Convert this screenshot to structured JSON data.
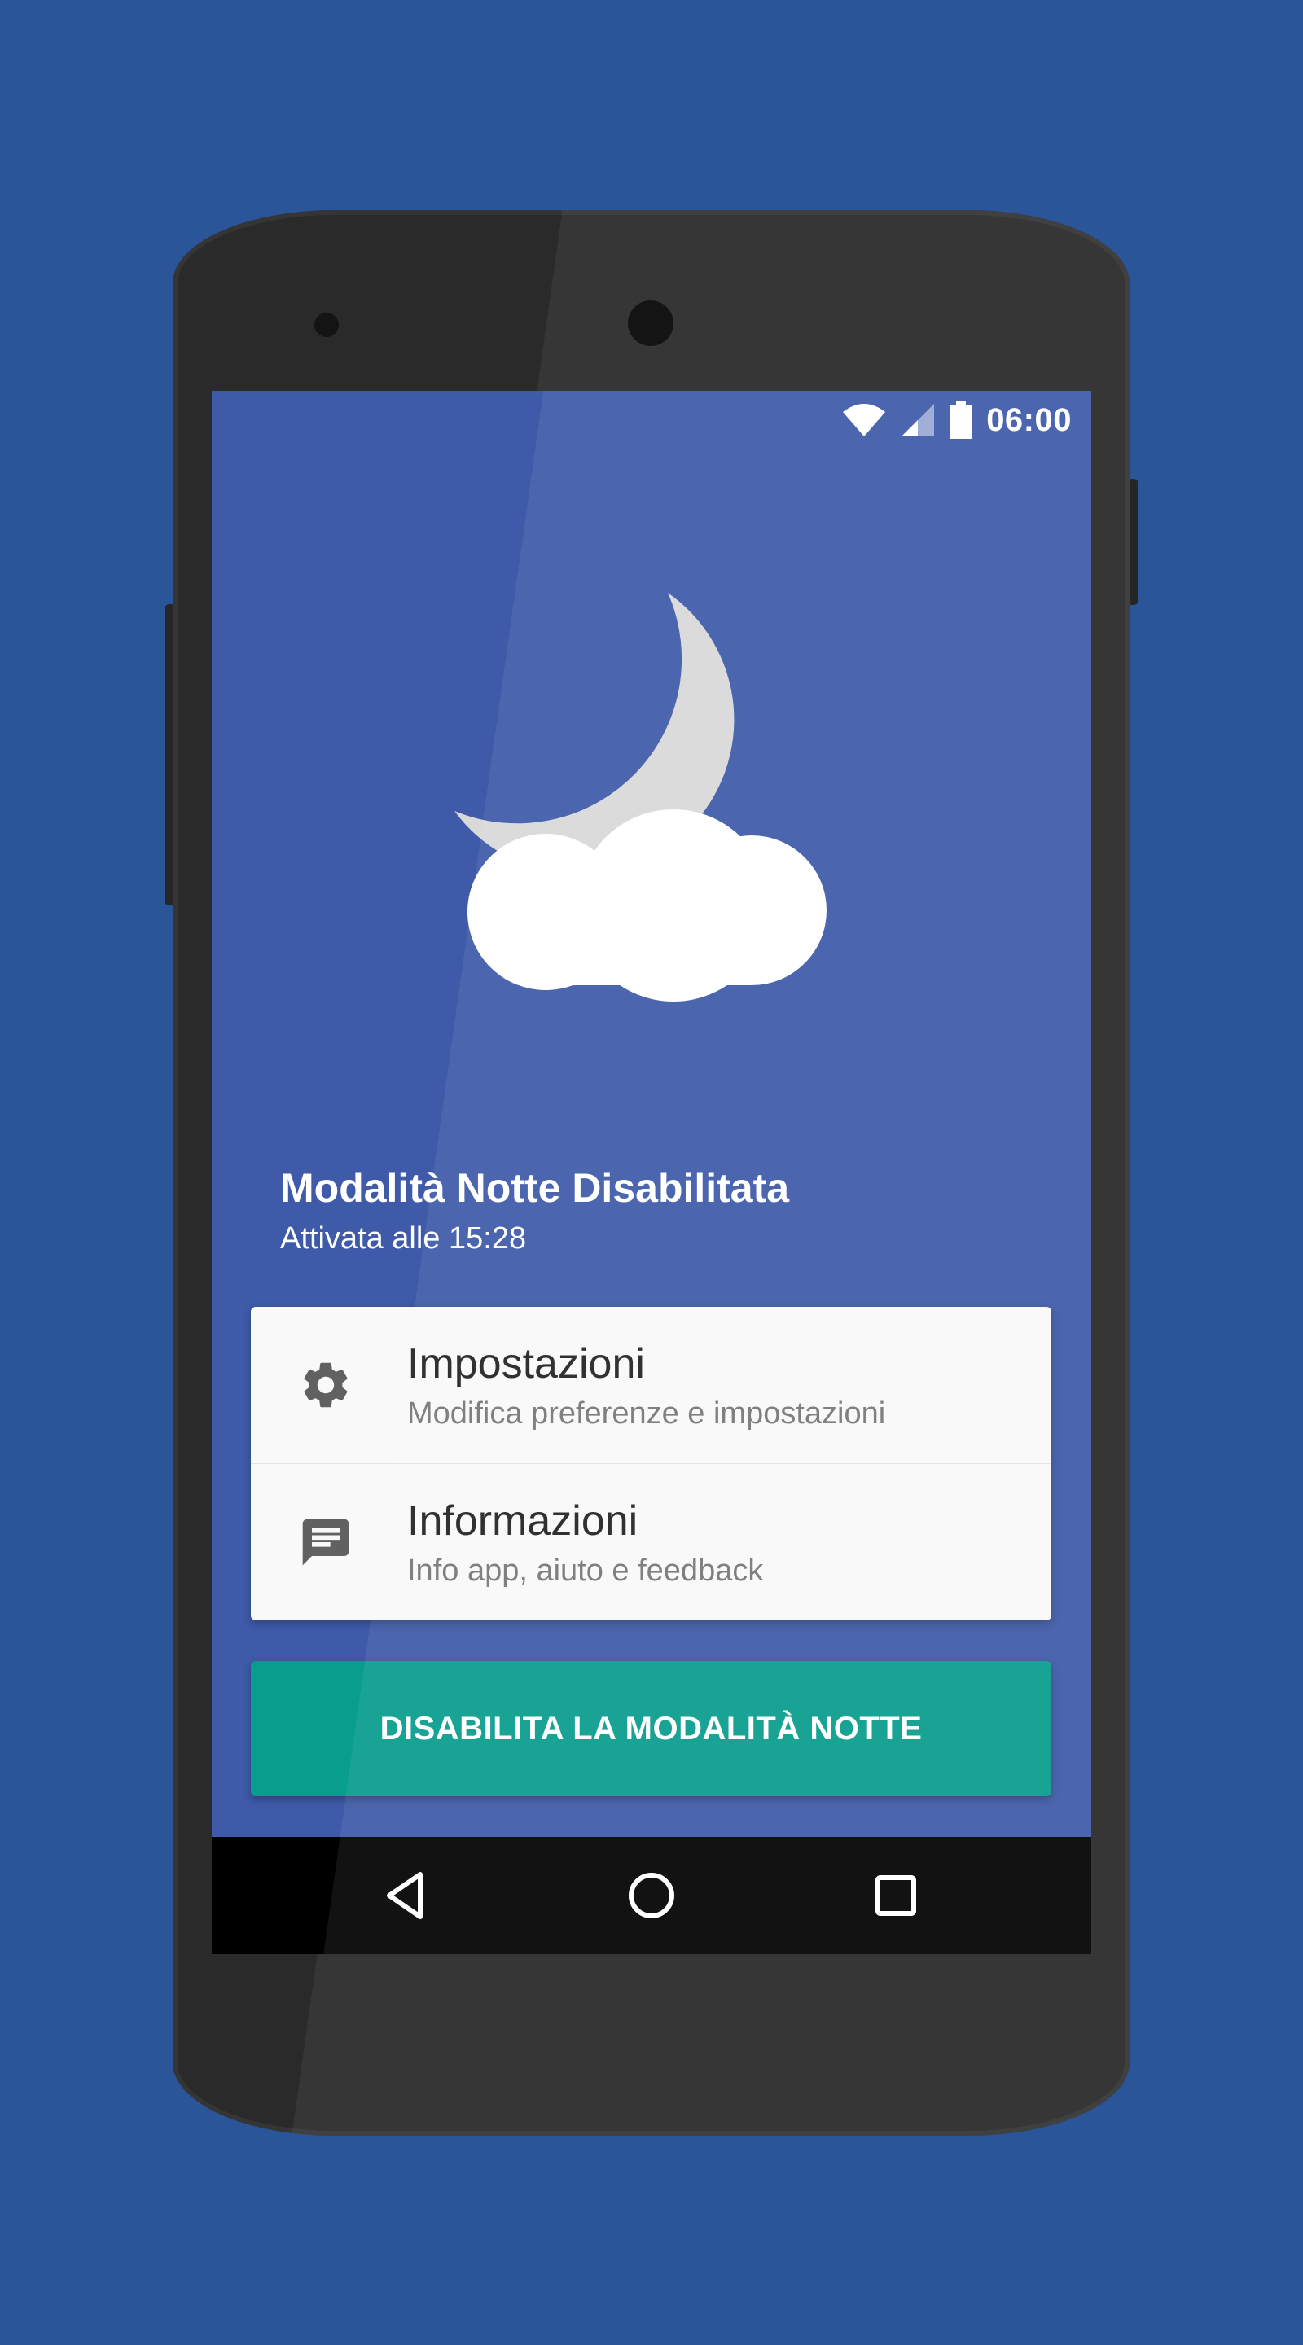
{
  "colors": {
    "background": "#2a5699",
    "screen": "#3e5aa8",
    "card": "#f9f9f9",
    "accent_button": "#089d8d",
    "nav_bar": "#000000",
    "moon": "#d9d9d9",
    "cloud": "#ffffff"
  },
  "status_bar": {
    "time": "06:00",
    "icons": [
      "wifi-icon",
      "cell-signal-icon",
      "battery-icon"
    ]
  },
  "illustration": {
    "icons": [
      "moon-icon",
      "cloud-icon"
    ]
  },
  "header": {
    "title": "Modalità Notte Disabilitata",
    "subtitle": "Attivata  alle 15:28"
  },
  "menu": {
    "items": [
      {
        "icon": "gear-icon",
        "title": "Impostazioni",
        "subtitle": "Modifica preferenze e impostazioni"
      },
      {
        "icon": "chat-icon",
        "title": "Informazioni",
        "subtitle": "Info app, aiuto e feedback"
      }
    ]
  },
  "action_button": {
    "label": "DISABILITA LA MODALITÀ NOTTE"
  },
  "nav_bar": {
    "buttons": [
      "back-icon",
      "home-icon",
      "recents-icon"
    ]
  }
}
